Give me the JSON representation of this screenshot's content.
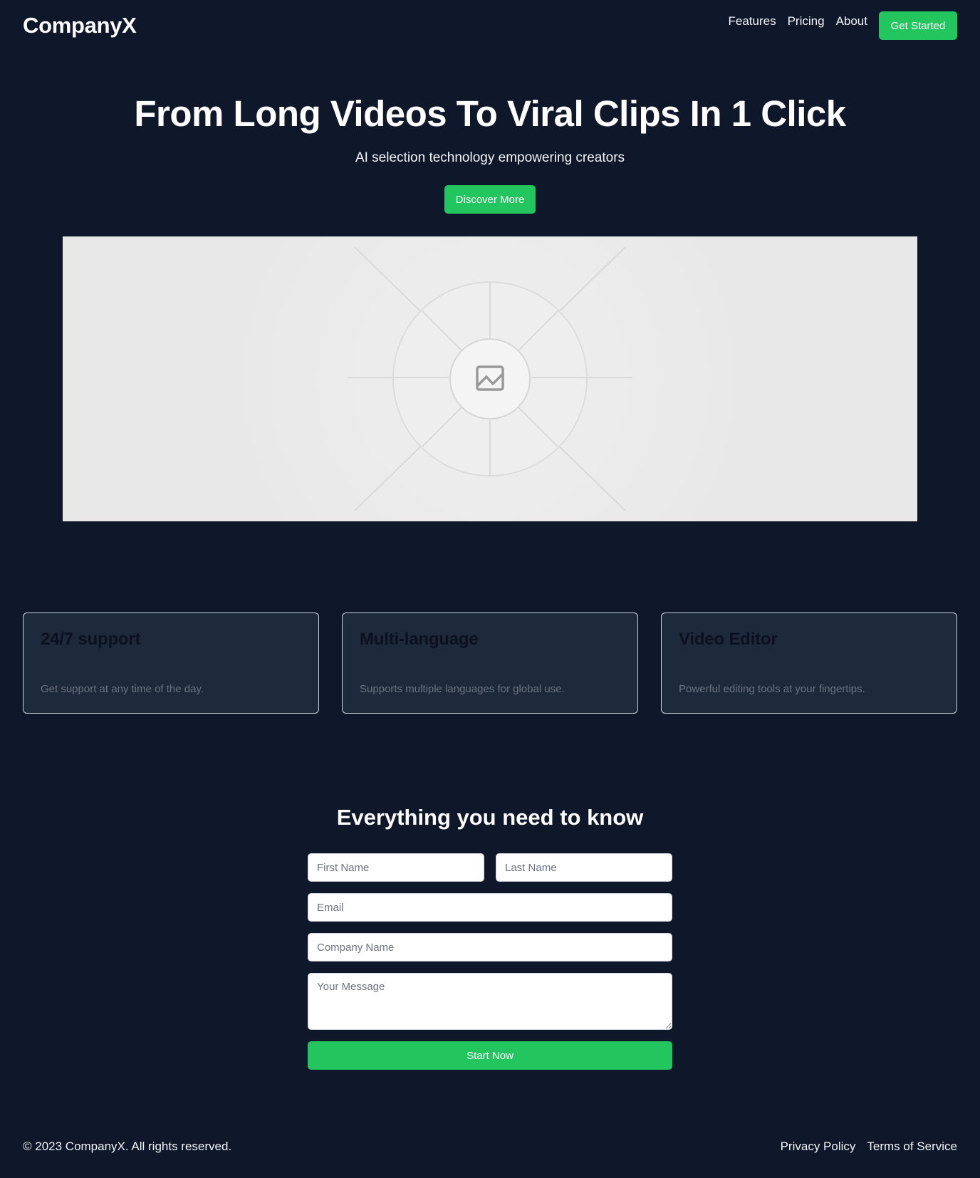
{
  "header": {
    "logo": "CompanyX",
    "nav": [
      "Features",
      "Pricing",
      "About"
    ],
    "cta_label": "Get Started"
  },
  "hero": {
    "title": "From Long Videos To Viral Clips In 1 Click",
    "subtitle": "AI selection technology empowering creators",
    "button_label": "Discover More",
    "image_icon": "image-icon"
  },
  "features": [
    {
      "title": "24/7 support",
      "description": "Get support at any time of the day."
    },
    {
      "title": "Multi-language",
      "description": "Supports multiple languages for global use."
    },
    {
      "title": "Video Editor",
      "description": "Powerful editing tools at your fingertips."
    }
  ],
  "contact": {
    "title": "Everything you need to know",
    "first_name_placeholder": "First Name",
    "last_name_placeholder": "Last Name",
    "email_placeholder": "Email",
    "company_placeholder": "Company Name",
    "message_placeholder": "Your Message",
    "submit_label": "Start Now"
  },
  "footer": {
    "copyright": "© 2023 CompanyX. All rights reserved.",
    "links": [
      "Privacy Policy",
      "Terms of Service"
    ]
  },
  "colors": {
    "background": "#0f172a",
    "accent": "#22c55e",
    "card_background": "#1e293b"
  }
}
